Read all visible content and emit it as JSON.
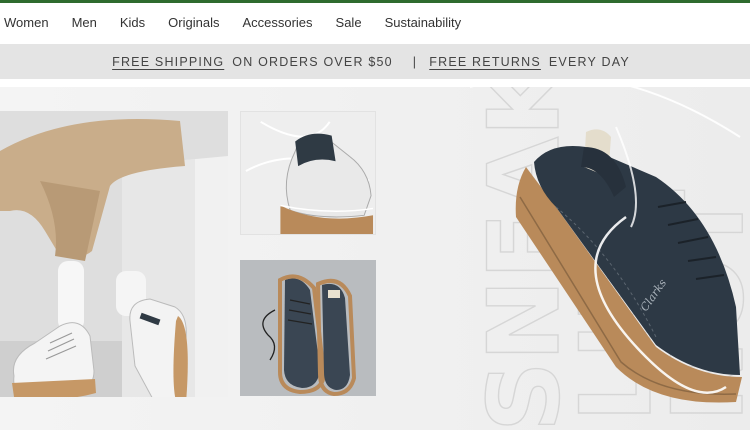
{
  "nav": {
    "items": [
      {
        "label": "Women"
      },
      {
        "label": "Men"
      },
      {
        "label": "Kids"
      },
      {
        "label": "Originals"
      },
      {
        "label": "Accessories"
      },
      {
        "label": "Sale"
      },
      {
        "label": "Sustainability"
      }
    ]
  },
  "promo": {
    "shipping_link": "FREE SHIPPING",
    "shipping_text": "ON ORDERS OVER $50",
    "separator": "|",
    "returns_link": "FREE RETURNS",
    "returns_text": "EVERY DAY"
  },
  "hero": {
    "bg_words": [
      "SNEAK",
      "LIN",
      "NOT"
    ],
    "shoe_brand_text": "Clarks"
  },
  "colors": {
    "accent_green": "#2e6b2e",
    "promo_bar": "#e4e4e4",
    "shoe_navy": "#2d3945",
    "sole_gum": "#b98a5a"
  }
}
